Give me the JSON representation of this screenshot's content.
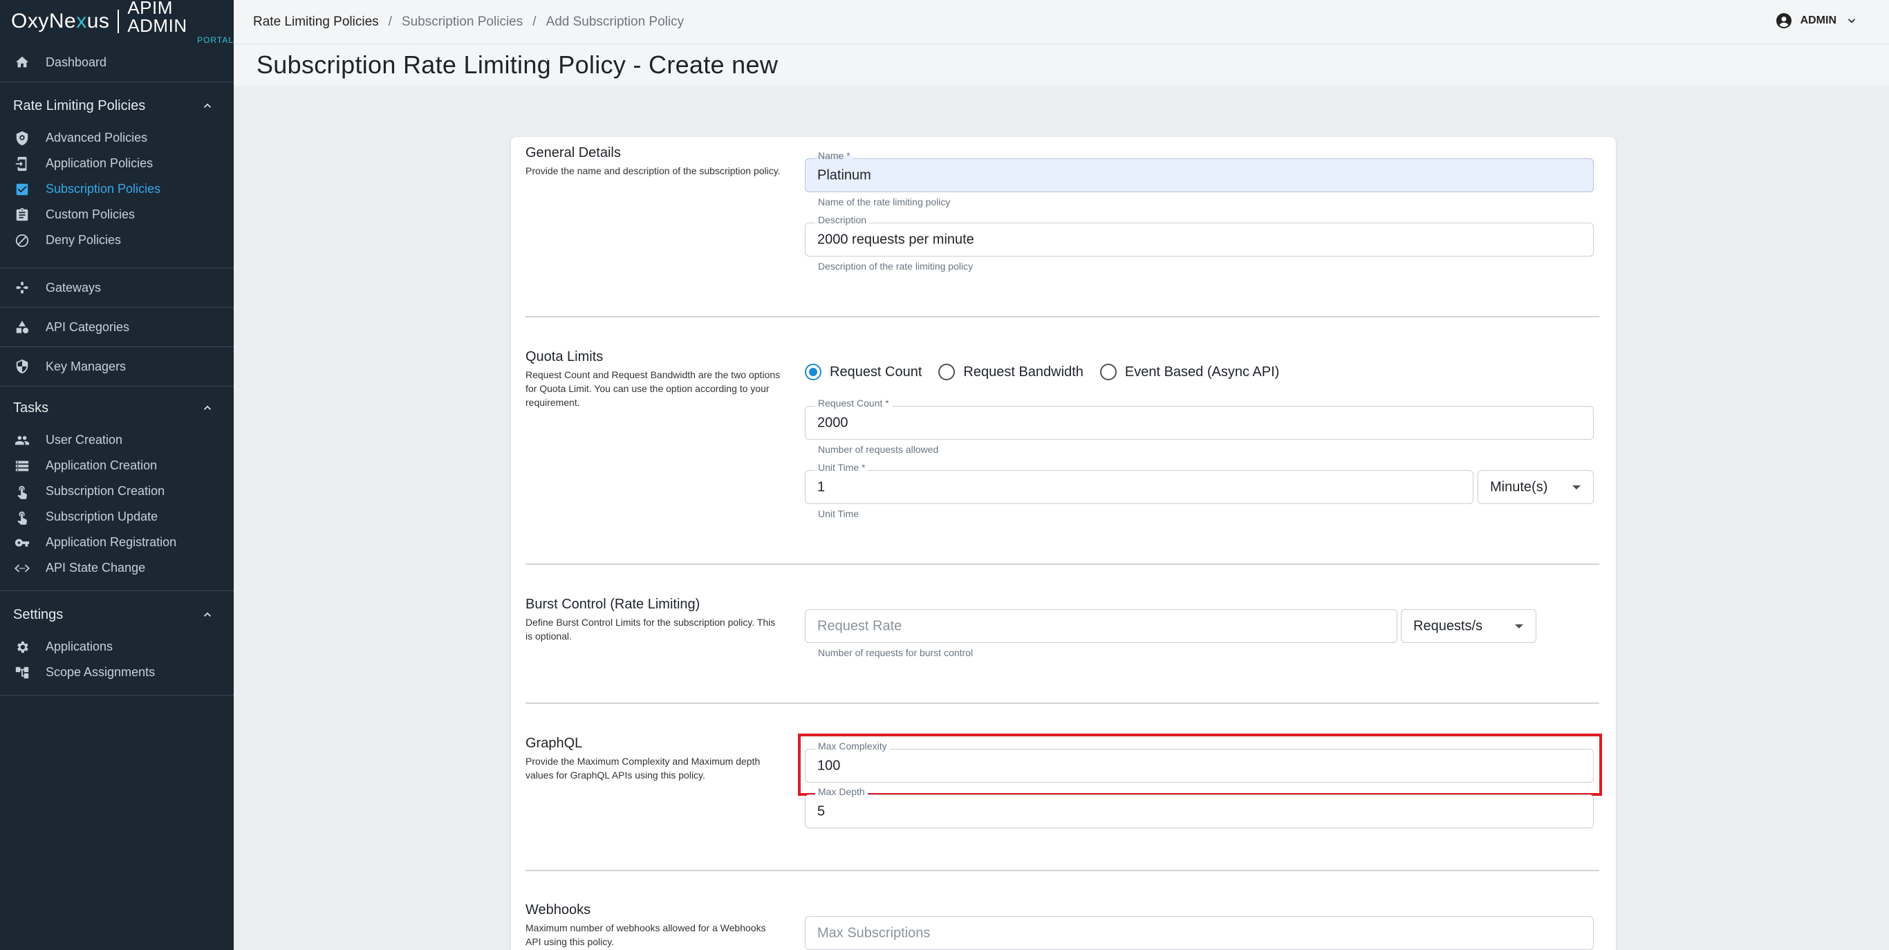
{
  "brand": {
    "logo_pre": "OxyNe",
    "logo_x": "x",
    "logo_post": "us",
    "title": "APIM ADMIN",
    "subtitle": "PORTAL"
  },
  "sidebar": {
    "dashboard": "Dashboard",
    "rate_section": "Rate Limiting Policies",
    "rate_items": [
      "Advanced Policies",
      "Application Policies",
      "Subscription Policies",
      "Custom Policies",
      "Deny Policies"
    ],
    "gateways": "Gateways",
    "api_categories": "API Categories",
    "key_managers": "Key Managers",
    "tasks_section": "Tasks",
    "task_items": [
      "User Creation",
      "Application Creation",
      "Subscription Creation",
      "Subscription Update",
      "Application Registration",
      "API State Change"
    ],
    "settings_section": "Settings",
    "settings_items": [
      "Applications",
      "Scope Assignments"
    ]
  },
  "breadcrumb": [
    "Rate Limiting Policies",
    "Subscription Policies",
    "Add Subscription Policy"
  ],
  "user": {
    "name": "ADMIN"
  },
  "page_title": "Subscription Rate Limiting Policy - Create new",
  "general": {
    "title": "General Details",
    "desc": "Provide the name and description of the subscription policy.",
    "name_label": "Name *",
    "name_value": "Platinum",
    "name_helper": "Name of the rate limiting policy",
    "desc_label": "Description",
    "desc_value": "2000 requests per minute",
    "desc_helper": "Description of the rate limiting policy"
  },
  "quota": {
    "title": "Quota Limits",
    "desc": "Request Count and Request Bandwidth are the two options for Quota Limit. You can use the option according to your requirement.",
    "options": [
      "Request Count",
      "Request Bandwidth",
      "Event Based (Async API)"
    ],
    "selected": "Request Count",
    "count_label": "Request Count *",
    "count_value": "2000",
    "count_helper": "Number of requests allowed",
    "unit_label": "Unit Time *",
    "unit_value": "1",
    "unit_select": "Minute(s)",
    "unit_helper": "Unit Time"
  },
  "burst": {
    "title": "Burst Control (Rate Limiting)",
    "desc": "Define Burst Control Limits for the subscription policy. This is optional.",
    "rate_placeholder": "Request Rate",
    "rate_select": "Requests/s",
    "rate_helper": "Number of requests for burst control"
  },
  "graphql": {
    "title": "GraphQL",
    "desc": "Provide the Maximum Complexity and Maximum depth values for GraphQL APIs using this policy.",
    "complexity_label": "Max Complexity",
    "complexity_value": "100",
    "depth_label": "Max Depth",
    "depth_value": "5"
  },
  "webhooks": {
    "title": "Webhooks",
    "desc": "Maximum number of webhooks allowed for a Webhooks API using this policy.",
    "subs_placeholder": "Max Subscriptions"
  },
  "colors": {
    "sidebar_bg": "#1b2733",
    "accent": "#1a8ad3",
    "active_nav": "#3aa8e8",
    "highlight": "#e01b24",
    "filled_input": "#e9f0fd"
  }
}
